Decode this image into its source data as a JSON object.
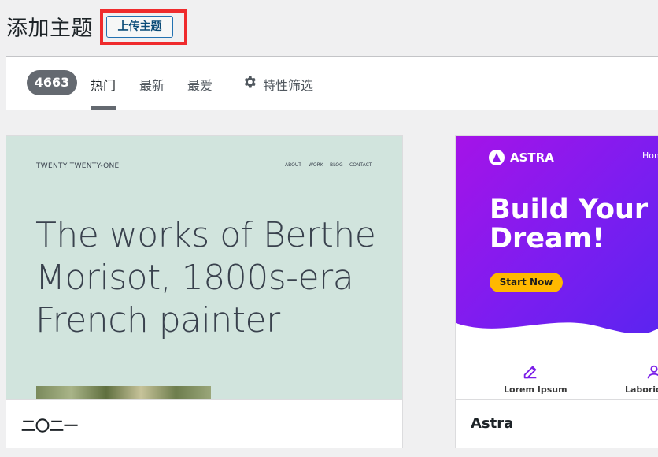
{
  "header": {
    "title": "添加主题",
    "upload_label": "上传主题"
  },
  "filter_bar": {
    "count": "4663",
    "tabs": [
      {
        "label": "热门",
        "active": true
      },
      {
        "label": "最新",
        "active": false
      },
      {
        "label": "最爱",
        "active": false
      }
    ],
    "feature_filter_label": "特性筛选",
    "feature_filter_icon": "gear-icon"
  },
  "themes": [
    {
      "name": "二〇二一",
      "preview": {
        "site_title": "TWENTY TWENTY-ONE",
        "menu": [
          "ABOUT",
          "WORK",
          "BLOG",
          "CONTACT"
        ],
        "headline": "The works of Berthe Morisot, 1800s-era French painter",
        "background": "#d1e4dd"
      }
    },
    {
      "name": "Astra",
      "preview": {
        "logo_text": "ASTRA",
        "nav_partial": "Hom",
        "headline": "Build Your Dream!",
        "cta": "Start Now",
        "features": [
          {
            "label": "Lorem Ipsum",
            "icon": "edit-icon"
          },
          {
            "label": "Laborio",
            "icon": "user-icon"
          }
        ]
      }
    }
  ],
  "colors": {
    "accent": "#2271b1",
    "highlight": "#ef2b2d",
    "astra_purple": "#8d19eb",
    "astra_cta": "#ffb800"
  }
}
